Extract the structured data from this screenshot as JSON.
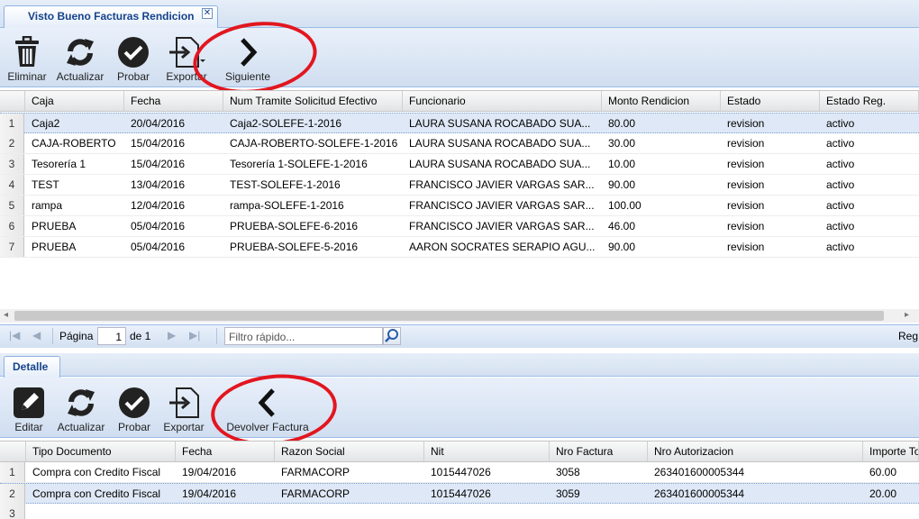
{
  "window": {
    "tab_title": "Visto Bueno Facturas Rendicion",
    "close_label": "✕"
  },
  "top_toolbar": {
    "eliminar": "Eliminar",
    "actualizar": "Actualizar",
    "probar": "Probar",
    "exportar": "Exportar",
    "siguiente": "Siguiente"
  },
  "top_grid": {
    "columns": [
      "Caja",
      "Fecha",
      "Num Tramite Solicitud Efectivo",
      "Funcionario",
      "Monto Rendicion",
      "Estado",
      "Estado Reg."
    ],
    "rows": [
      [
        "1",
        "Caja2",
        "20/04/2016",
        "Caja2-SOLEFE-1-2016",
        "LAURA SUSANA ROCABADO SUA...",
        "80.00",
        "revision",
        "activo"
      ],
      [
        "2",
        "CAJA-ROBERTO",
        "15/04/2016",
        "CAJA-ROBERTO-SOLEFE-1-2016",
        "LAURA SUSANA ROCABADO SUA...",
        "30.00",
        "revision",
        "activo"
      ],
      [
        "3",
        "Tesorería 1",
        "15/04/2016",
        "Tesorería 1-SOLEFE-1-2016",
        "LAURA SUSANA ROCABADO SUA...",
        "10.00",
        "revision",
        "activo"
      ],
      [
        "4",
        "TEST",
        "13/04/2016",
        "TEST-SOLEFE-1-2016",
        "FRANCISCO JAVIER VARGAS SAR...",
        "90.00",
        "revision",
        "activo"
      ],
      [
        "5",
        "rampa",
        "12/04/2016",
        "rampa-SOLEFE-1-2016",
        "FRANCISCO JAVIER VARGAS SAR...",
        "100.00",
        "revision",
        "activo"
      ],
      [
        "6",
        "PRUEBA",
        "05/04/2016",
        "PRUEBA-SOLEFE-6-2016",
        "FRANCISCO JAVIER VARGAS SAR...",
        "46.00",
        "revision",
        "activo"
      ],
      [
        "7",
        "PRUEBA",
        "05/04/2016",
        "PRUEBA-SOLEFE-5-2016",
        "AARON SOCRATES SERAPIO AGU...",
        "90.00",
        "revision",
        "activo"
      ]
    ]
  },
  "pager": {
    "page_label": "Página",
    "page_value": "1",
    "of_label": "de 1",
    "quick_filter_placeholder": "Filtro rápido...",
    "right_text": "Reg"
  },
  "detail": {
    "tab_label": "Detalle"
  },
  "bottom_toolbar": {
    "editar": "Editar",
    "actualizar": "Actualizar",
    "probar": "Probar",
    "exportar": "Exportar",
    "devolver": "Devolver Factura"
  },
  "bottom_grid": {
    "columns": [
      "Tipo Documento",
      "Fecha",
      "Razon Social",
      "Nit",
      "Nro Factura",
      "Nro Autorizacion",
      "Importe To"
    ],
    "rows": [
      [
        "1",
        "Compra con Credito Fiscal",
        "19/04/2016",
        "FARMACORP",
        "1015447026",
        "3058",
        "263401600005344",
        "60.00"
      ],
      [
        "2",
        "Compra con Credito Fiscal",
        "19/04/2016",
        "FARMACORP",
        "1015447026",
        "3059",
        "263401600005344",
        "20.00"
      ],
      [
        "3",
        "",
        "",
        "",
        "",
        "",
        "",
        ""
      ]
    ]
  },
  "colors": {
    "accent": "#15428b",
    "highlight": "#e2161f",
    "selection": "#dfe8f6"
  }
}
